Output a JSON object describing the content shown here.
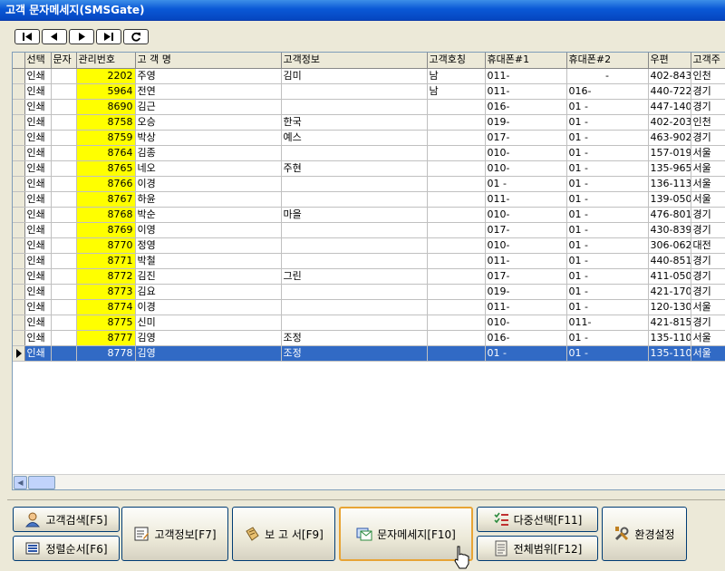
{
  "window": {
    "title": "고객 문자메세지(SMSGate)"
  },
  "navigator": {
    "buttons": [
      "first-record",
      "previous-record",
      "next-record",
      "last-record",
      "refresh"
    ]
  },
  "grid": {
    "columns": [
      "선택",
      "문자",
      "관리번호",
      "고 객 명",
      "고객정보",
      "고객호칭",
      "휴대폰#1",
      "휴대폰#2",
      "우편",
      "고객주"
    ],
    "rows": [
      {
        "select": "인쇄",
        "sms": "",
        "id": "2202",
        "name": "주영",
        "info": "김미",
        "title": "남",
        "phone1": "011-",
        "phone2": "-",
        "zip": "402-843",
        "addr": "인천"
      },
      {
        "select": "인쇄",
        "sms": "",
        "id": "5964",
        "name": "전연",
        "info": "",
        "title": "남",
        "phone1": "011-",
        "phone2": "016-",
        "zip": "440-722",
        "addr": "경기"
      },
      {
        "select": "인쇄",
        "sms": "",
        "id": "8690",
        "name": "김근",
        "info": "",
        "title": "",
        "phone1": "016-",
        "phone2": "01 -",
        "zip": "447-140",
        "addr": "경기"
      },
      {
        "select": "인쇄",
        "sms": "",
        "id": "8758",
        "name": "오승",
        "info": "한국",
        "title": "",
        "phone1": "019-",
        "phone2": "01 -",
        "zip": "402-203",
        "addr": "인천"
      },
      {
        "select": "인쇄",
        "sms": "",
        "id": "8759",
        "name": "박상",
        "info": "예스",
        "title": "",
        "phone1": "017-",
        "phone2": "01 -",
        "zip": "463-902",
        "addr": "경기"
      },
      {
        "select": "인쇄",
        "sms": "",
        "id": "8764",
        "name": "김종",
        "info": "",
        "title": "",
        "phone1": "010-",
        "phone2": "01 -",
        "zip": "157-019",
        "addr": "서울"
      },
      {
        "select": "인쇄",
        "sms": "",
        "id": "8765",
        "name": "네오",
        "info": "주현",
        "title": "",
        "phone1": "010-",
        "phone2": "01 -",
        "zip": "135-965",
        "addr": "서울"
      },
      {
        "select": "인쇄",
        "sms": "",
        "id": "8766",
        "name": "이경",
        "info": "",
        "title": "",
        "phone1": "01 -",
        "phone2": "01 -",
        "zip": "136-113",
        "addr": "서울"
      },
      {
        "select": "인쇄",
        "sms": "",
        "id": "8767",
        "name": "하윤",
        "info": "",
        "title": "",
        "phone1": "011-",
        "phone2": "01 -",
        "zip": "139-050",
        "addr": "서울"
      },
      {
        "select": "인쇄",
        "sms": "",
        "id": "8768",
        "name": "박순",
        "info": "마을",
        "title": "",
        "phone1": "010-",
        "phone2": "01 -",
        "zip": "476-801",
        "addr": "경기"
      },
      {
        "select": "인쇄",
        "sms": "",
        "id": "8769",
        "name": "이영",
        "info": "",
        "title": "",
        "phone1": "017-",
        "phone2": "01 -",
        "zip": "430-839",
        "addr": "경기"
      },
      {
        "select": "인쇄",
        "sms": "",
        "id": "8770",
        "name": "정영",
        "info": "",
        "title": "",
        "phone1": "010-",
        "phone2": "01 -",
        "zip": "306-062",
        "addr": "대전"
      },
      {
        "select": "인쇄",
        "sms": "",
        "id": "8771",
        "name": "박철",
        "info": "",
        "title": "",
        "phone1": "011-",
        "phone2": "01 -",
        "zip": "440-851",
        "addr": "경기"
      },
      {
        "select": "인쇄",
        "sms": "",
        "id": "8772",
        "name": "김진",
        "info": "그린",
        "title": "",
        "phone1": "017-",
        "phone2": "01 -",
        "zip": "411-050",
        "addr": "경기"
      },
      {
        "select": "인쇄",
        "sms": "",
        "id": "8773",
        "name": "김요",
        "info": "",
        "title": "",
        "phone1": "019-",
        "phone2": "01 -",
        "zip": "421-170",
        "addr": "경기"
      },
      {
        "select": "인쇄",
        "sms": "",
        "id": "8774",
        "name": "이경",
        "info": "",
        "title": "",
        "phone1": "011-",
        "phone2": "01 -",
        "zip": "120-130",
        "addr": "서울"
      },
      {
        "select": "인쇄",
        "sms": "",
        "id": "8775",
        "name": "신미",
        "info": "",
        "title": "",
        "phone1": "010-",
        "phone2": "011-",
        "zip": "421-815",
        "addr": "경기"
      },
      {
        "select": "인쇄",
        "sms": "",
        "id": "8777",
        "name": "김영",
        "info": "조정",
        "title": "",
        "phone1": "016-",
        "phone2": "01 -",
        "zip": "135-110",
        "addr": "서울"
      },
      {
        "select": "인쇄",
        "sms": "",
        "id": "8778",
        "name": "김영",
        "info": "조정",
        "title": "",
        "phone1": "01 -",
        "phone2": "01 -",
        "zip": "135-110",
        "addr": "서울",
        "selected": true
      }
    ]
  },
  "buttons": {
    "customer_search": "고객검색[F5]",
    "sort_order": "정렬순서[F6]",
    "customer_info": "고객정보[F7]",
    "report": "보 고 서[F9]",
    "sms_message": "문자메세지[F10]",
    "multi_select": "다중선택[F11]",
    "full_range": "전체범위[F12]",
    "settings": "환경설정"
  },
  "colors": {
    "title_bar": "#0a58d6",
    "selection": "#316ac5",
    "id_highlight": "#ffff00",
    "face": "#ece9d8"
  }
}
